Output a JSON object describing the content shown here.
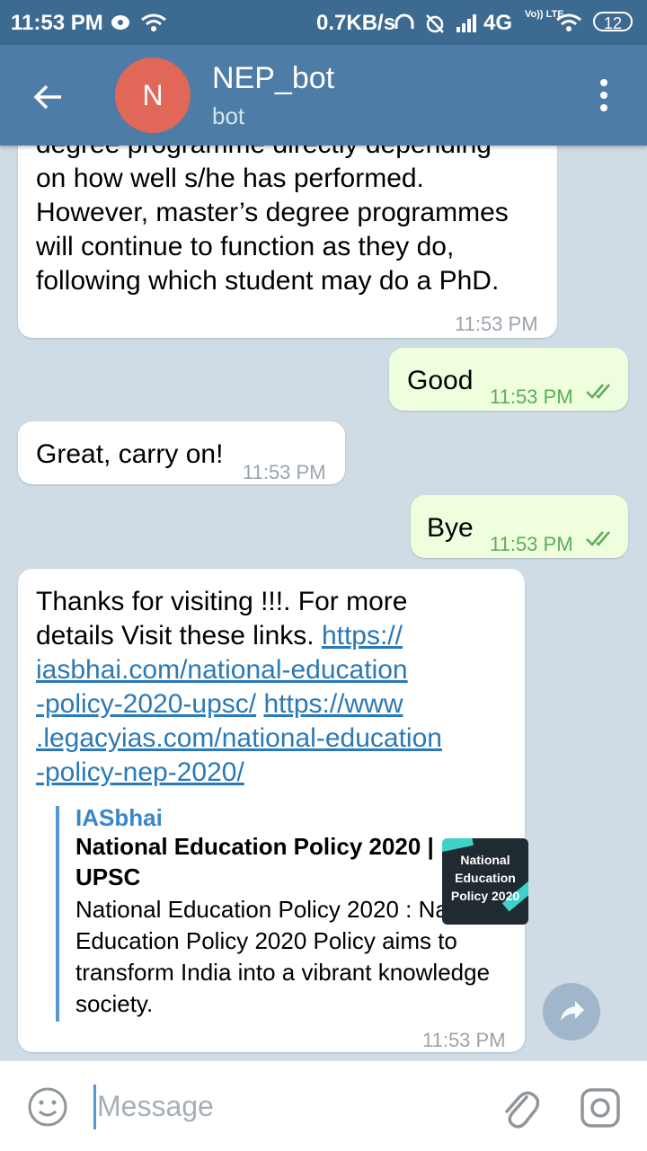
{
  "status_bar": {
    "time": "11:53 PM",
    "net_speed": "0.7KB/s",
    "network": "4G",
    "volte": "Vo)) LTE",
    "battery": "12"
  },
  "header": {
    "avatar_letter": "N",
    "title": "NEP_bot",
    "subtitle": "bot"
  },
  "messages": [
    {
      "direction": "in",
      "lines": [
        "degree programme directly depending",
        "on how well s/he has performed.",
        "However, master’s degree programmes",
        "will continue to function as they do,",
        "following which student may do a PhD."
      ],
      "time": "11:53 PM"
    },
    {
      "direction": "out",
      "text": "Good",
      "time": "11:53 PM"
    },
    {
      "direction": "in",
      "text": "Great, carry on!",
      "time": "11:53 PM"
    },
    {
      "direction": "out",
      "text": "Bye",
      "time": "11:53 PM"
    },
    {
      "direction": "in",
      "line1": "Thanks for visiting !!!.    For more",
      "line2_text": "details Visit these links. ",
      "line2_link": "https://",
      "link_lines": [
        "iasbhai.com/national-education",
        "-policy-2020-upsc/"
      ],
      "link2_start": "https://www",
      "link2_lines": [
        ".legacyias.com/national-education",
        "-policy-nep-2020/"
      ],
      "preview": {
        "site": "IASbhai",
        "title": "National Education Policy 2020 | UPSC",
        "description": "National Education Policy 2020 : National Education Policy 2020 Policy aims to transform India into a vibrant knowledge society.",
        "thumb_lines": [
          "National",
          "Education",
          "Policy 2020"
        ]
      },
      "time": "11:53 PM"
    }
  ],
  "input": {
    "placeholder": "Message"
  }
}
